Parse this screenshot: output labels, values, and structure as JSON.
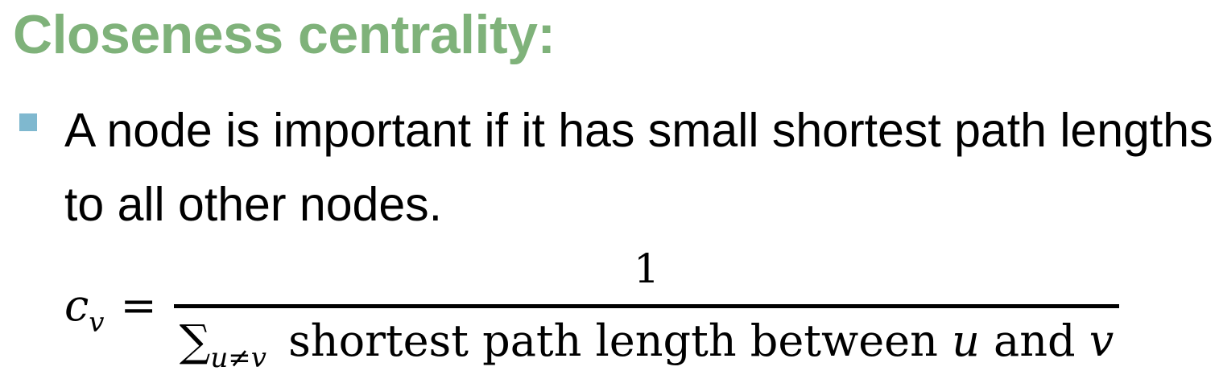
{
  "slide": {
    "title": "Closeness centrality:",
    "bullet": "A node is important if it has small shortest path lengths to all other nodes.",
    "formula": {
      "lhs_symbol": "c",
      "lhs_subscript": "v",
      "equals": "=",
      "numerator": "1",
      "sum_symbol": "∑",
      "sum_subscript": "u≠v",
      "denominator_text": " shortest path length between ",
      "var_u": "u",
      "and_text": " and ",
      "var_v": "v"
    }
  },
  "colors": {
    "title": "#7fb27a",
    "bullet_marker": "#7fb8cf",
    "text": "#000000",
    "background": "#ffffff"
  }
}
